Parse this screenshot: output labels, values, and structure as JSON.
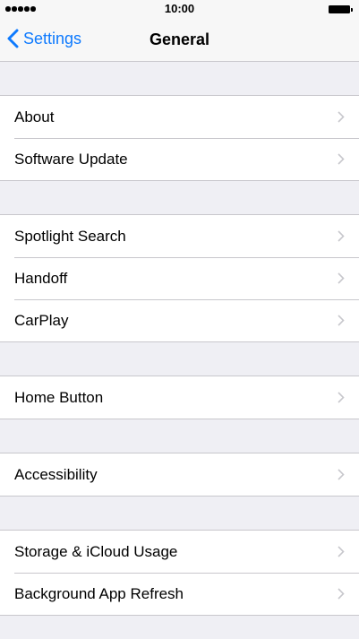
{
  "status_bar": {
    "signal_icon": "signal-dots-icon",
    "time": "10:00",
    "battery_icon": "battery-icon"
  },
  "nav": {
    "back_label": "Settings",
    "back_icon": "chevron-left-icon",
    "title": "General",
    "accent_color": "#0e7afe"
  },
  "groups": [
    {
      "items": [
        {
          "label": "About"
        },
        {
          "label": "Software Update"
        }
      ]
    },
    {
      "items": [
        {
          "label": "Spotlight Search"
        },
        {
          "label": "Handoff"
        },
        {
          "label": "CarPlay"
        }
      ]
    },
    {
      "items": [
        {
          "label": "Home Button"
        }
      ]
    },
    {
      "items": [
        {
          "label": "Accessibility"
        }
      ]
    },
    {
      "items": [
        {
          "label": "Storage & iCloud Usage"
        },
        {
          "label": "Background App Refresh"
        }
      ]
    }
  ],
  "row_icon": "chevron-right-icon",
  "colors": {
    "background": "#efeff4",
    "separator": "#c8c7cc",
    "chevron": "#c7c7cc"
  }
}
